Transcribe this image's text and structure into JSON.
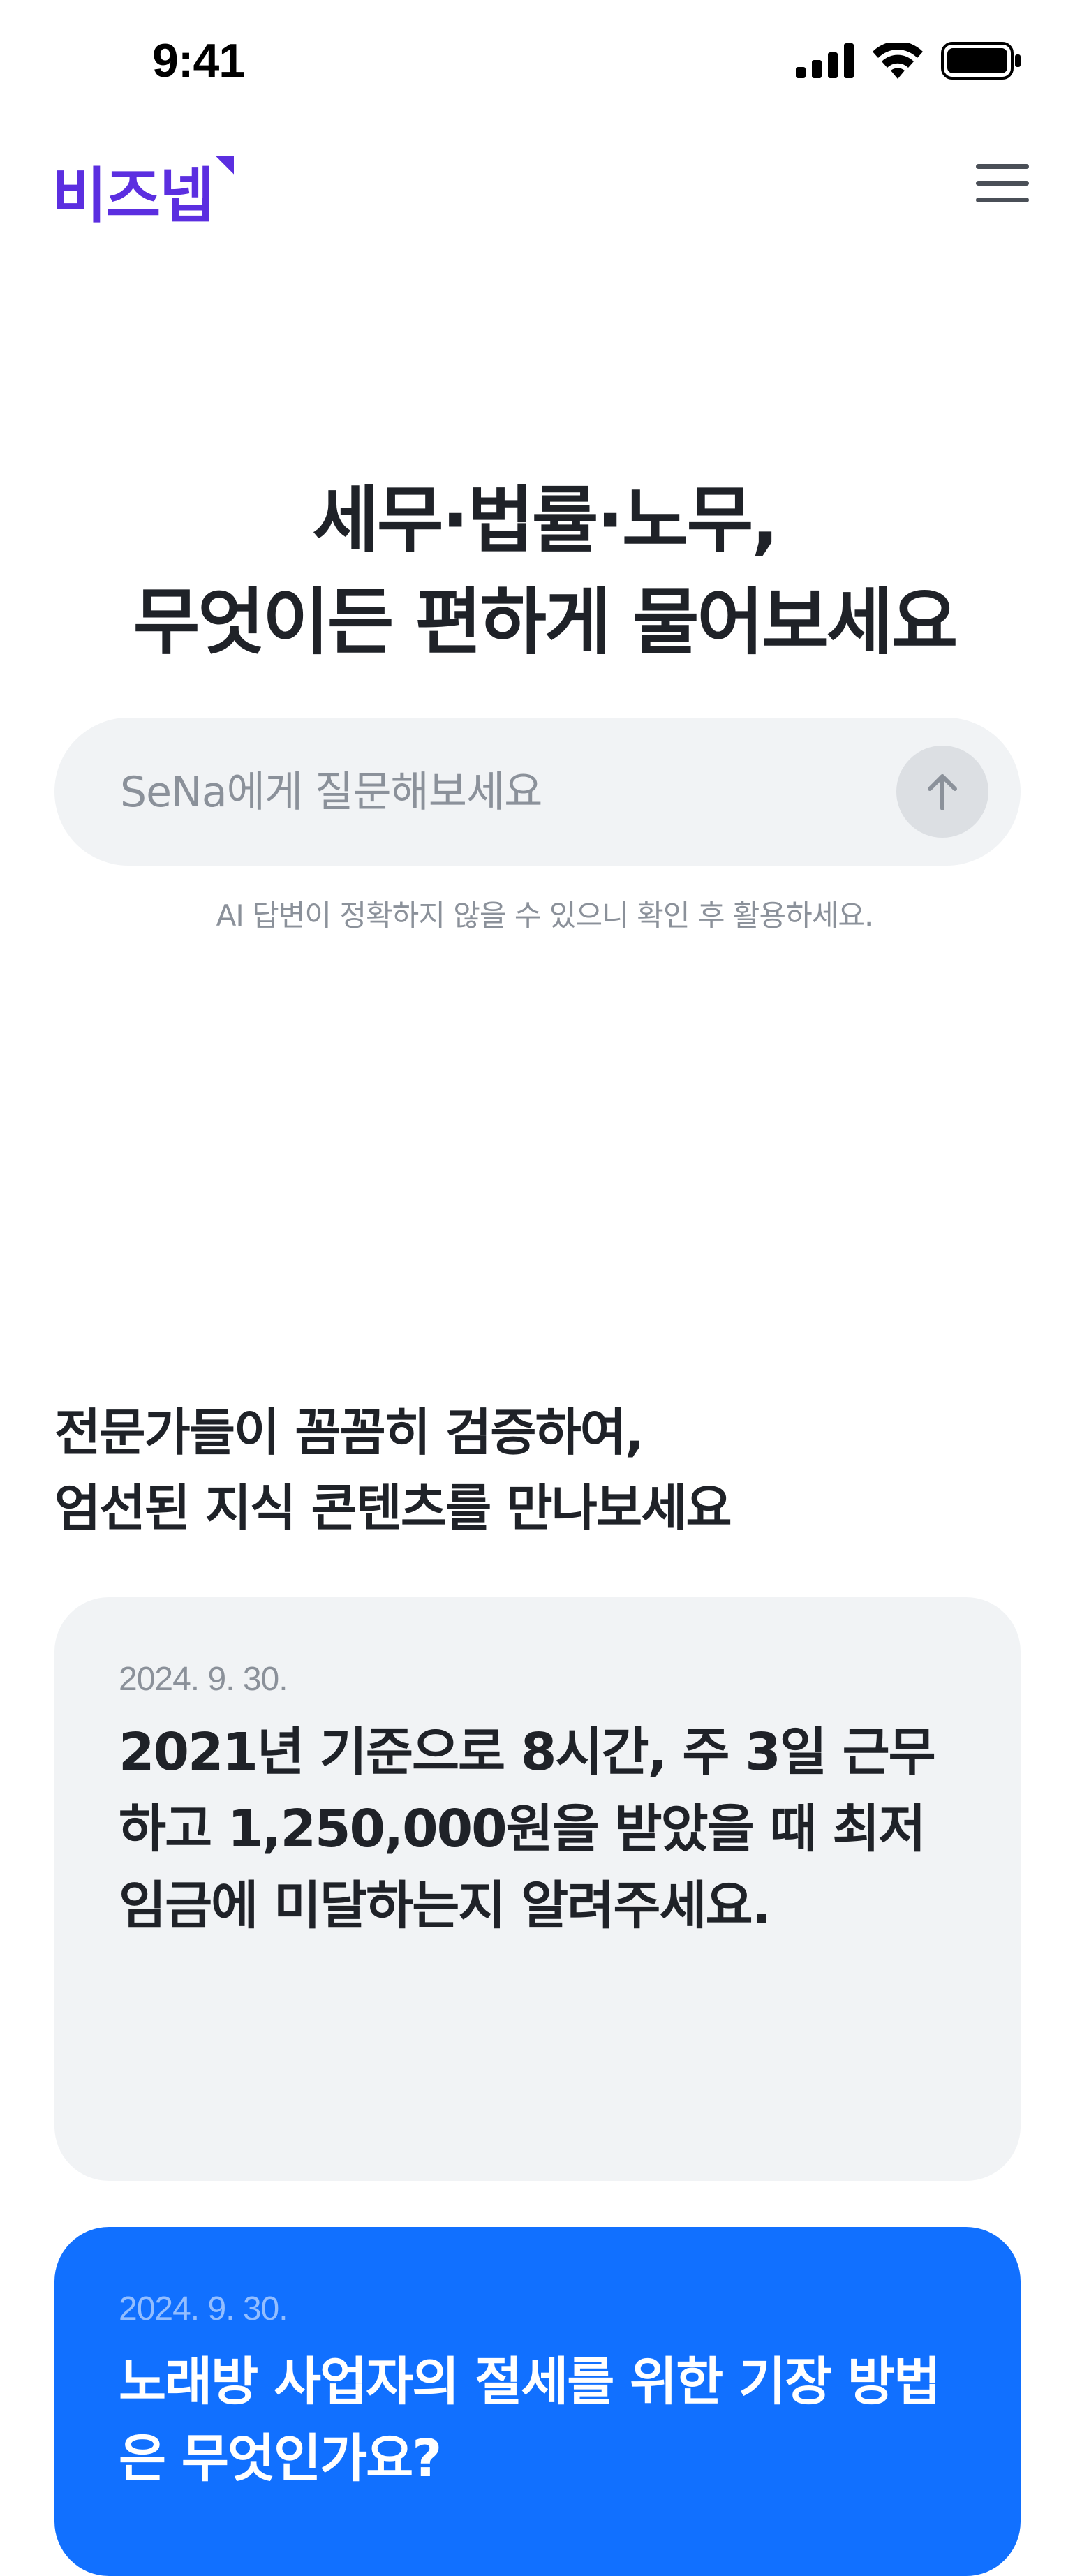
{
  "status_bar": {
    "time": "9:41",
    "icons": [
      "cellular-signal-icon",
      "wifi-icon",
      "battery-icon"
    ]
  },
  "header": {
    "logo_text": "비즈넵",
    "menu_icon": "hamburger-menu-icon"
  },
  "hero": {
    "title_line1": "세무·법률·노무,",
    "title_line2": "무엇이든 편하게 물어보세요",
    "search_placeholder": "SeNa에게 질문해보세요",
    "send_icon": "arrow-up-icon",
    "disclaimer": "AI 답변이 정확하지 않을 수 있으니 확인 후 활용하세요."
  },
  "contents": {
    "section_title_line1": "전문가들이 꼼꼼히 검증하여,",
    "section_title_line2": "엄선된 지식 콘텐츠를 만나보세요",
    "cards": [
      {
        "date": "2024. 9. 30.",
        "title": "2021년 기준으로 8시간, 주 3일 근무하고 1,250,000원을 받았을 때 최저임금에 미달하는지 알려주세요."
      },
      {
        "date": "2024. 9. 30.",
        "title": "노래방 사업자의 절세를 위한 기장 방법은 무엇인가요?"
      }
    ]
  },
  "colors": {
    "brand": "#5b2ee0",
    "accent_card": "#1170ff",
    "card_bg": "#f1f3f5",
    "text_primary": "#1f2228",
    "text_muted": "#8b919a"
  }
}
